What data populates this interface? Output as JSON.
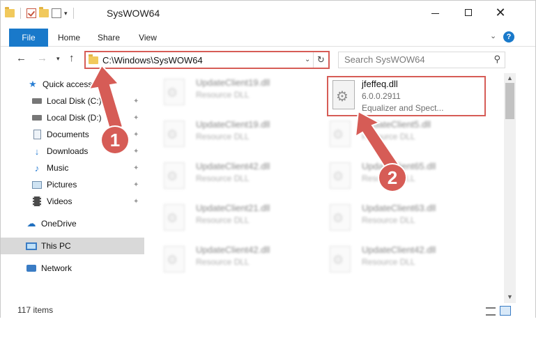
{
  "window": {
    "title": "SysWOW64",
    "minimize_glyph": "",
    "maximize_glyph": "",
    "close_glyph": "✕"
  },
  "ribbon": {
    "tabs": [
      {
        "label": "File",
        "active": true
      },
      {
        "label": "Home"
      },
      {
        "label": "Share"
      },
      {
        "label": "View"
      }
    ],
    "help_glyph": "?",
    "expand_glyph": "⌄"
  },
  "navigation": {
    "back_glyph": "←",
    "forward_glyph": "→",
    "recent_glyph": "▾",
    "up_glyph": "↑",
    "address": "C:\\Windows\\SysWOW64",
    "address_dropdown_glyph": "⌄",
    "refresh_glyph": "↻",
    "search_placeholder": "Search SysWOW64",
    "search_glyph": "⚲"
  },
  "sidebar": {
    "quick_access": "Quick access",
    "items": [
      {
        "label": "Local Disk (C:)",
        "icon": "drive-icon",
        "pinned": true
      },
      {
        "label": "Local Disk (D:)",
        "icon": "drive-icon",
        "pinned": true
      },
      {
        "label": "Documents",
        "icon": "documents-icon",
        "pinned": true
      },
      {
        "label": "Downloads",
        "icon": "downloads-icon",
        "pinned": true
      },
      {
        "label": "Music",
        "icon": "music-icon",
        "pinned": true
      },
      {
        "label": "Pictures",
        "icon": "pictures-icon",
        "pinned": true
      },
      {
        "label": "Videos",
        "icon": "videos-icon",
        "pinned": true
      }
    ],
    "onedrive": "OneDrive",
    "this_pc": "This PC",
    "network": "Network",
    "pin_glyph": "📌"
  },
  "files": {
    "blurred_tiles": [
      {
        "name": "UpdateClient19.dll",
        "type": "Resource DLL"
      },
      {
        "name": "UpdateClient19.dll",
        "type": "Resource DLL"
      },
      {
        "name": "UpdateClient42.dll",
        "type": "Resource DLL"
      },
      {
        "name": "UpdateClient21.dll",
        "type": "Resource DLL"
      },
      {
        "name": "UpdateClient42.dll",
        "type": "Resource DLL"
      },
      {
        "name": "UpdateClient5.dll",
        "type": "Resource DLL"
      },
      {
        "name": "UpdateClient65.dll",
        "type": "Resource DLL"
      },
      {
        "name": "UpdateClient63.dll",
        "type": "Resource DLL"
      },
      {
        "name": "UpdateClient42.dll",
        "type": "Resource DLL"
      }
    ],
    "highlighted": {
      "name": "jfeffeq.dll",
      "version": "6.0.0.2911",
      "description": "Equalizer and Spect..."
    }
  },
  "status": {
    "item_count": "117 items"
  },
  "annotations": {
    "callout_1": "1",
    "callout_2": "2"
  },
  "colors": {
    "accent": "#1979ca",
    "annotation": "#d65c56",
    "selected_bg": "#d9d9d9"
  }
}
